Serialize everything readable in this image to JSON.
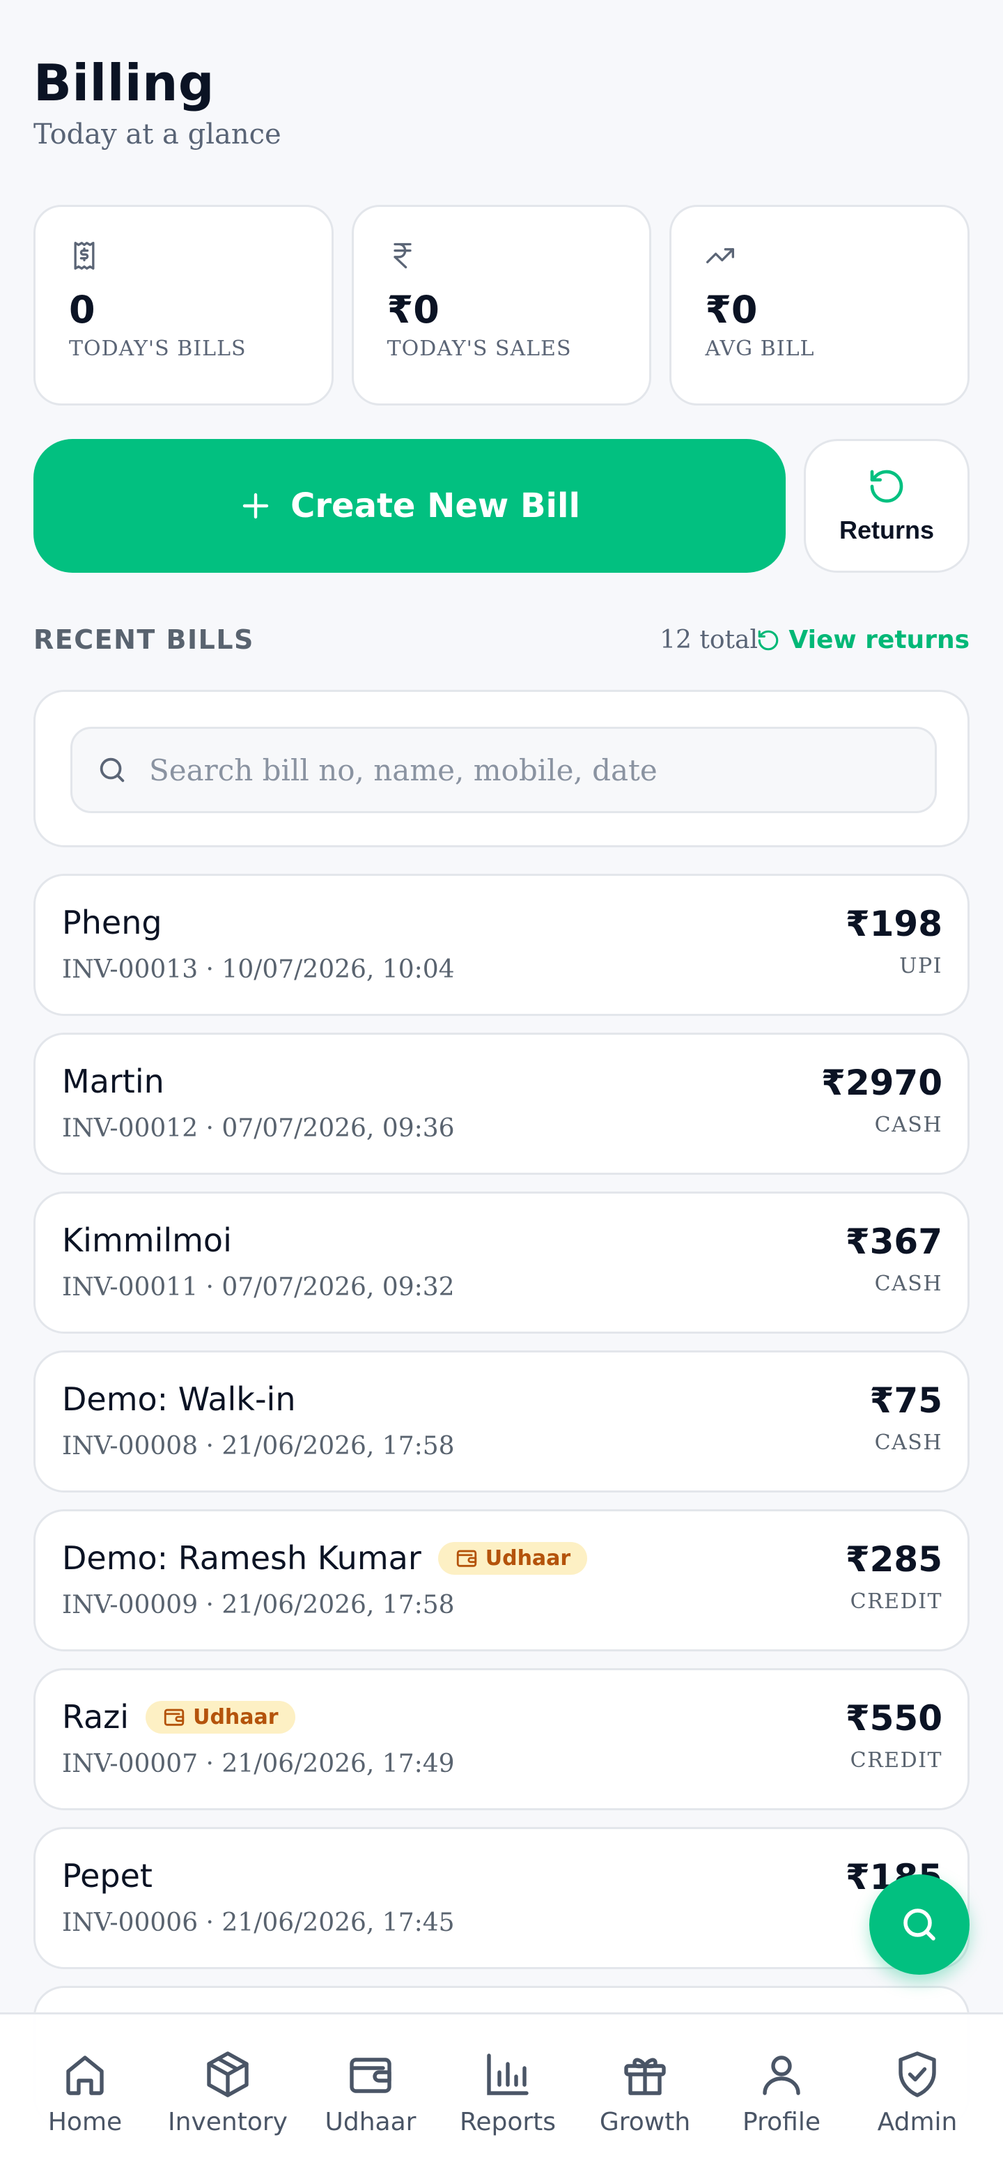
{
  "header": {
    "title": "Billing",
    "subtitle": "Today at a glance"
  },
  "stats": [
    {
      "icon": "receipt-icon",
      "value": "0",
      "label": "TODAY'S BILLS"
    },
    {
      "icon": "rupee-icon",
      "value": "₹0",
      "label": "TODAY'S SALES"
    },
    {
      "icon": "trending-up-icon",
      "value": "₹0",
      "label": "AVG BILL"
    }
  ],
  "actions": {
    "create_label": "Create New Bill",
    "returns_label": "Returns"
  },
  "recent": {
    "title": "RECENT BILLS",
    "total": "12 total",
    "view_returns": "View returns"
  },
  "search": {
    "placeholder": "Search bill no, name, mobile, date",
    "value": ""
  },
  "bills": [
    {
      "name": "Pheng",
      "meta": "INV-00013 · 10/07/2026, 10:04",
      "amount": "₹198",
      "method": "UPI",
      "badge": ""
    },
    {
      "name": "Martin",
      "meta": "INV-00012 · 07/07/2026, 09:36",
      "amount": "₹2970",
      "method": "CASH",
      "badge": ""
    },
    {
      "name": "Kimmilmoi",
      "meta": "INV-00011 · 07/07/2026, 09:32",
      "amount": "₹367",
      "method": "CASH",
      "badge": ""
    },
    {
      "name": "Demo: Walk-in",
      "meta": "INV-00008 · 21/06/2026, 17:58",
      "amount": "₹75",
      "method": "CASH",
      "badge": ""
    },
    {
      "name": "Demo: Ramesh Kumar",
      "meta": "INV-00009 · 21/06/2026, 17:58",
      "amount": "₹285",
      "method": "CREDIT",
      "badge": "Udhaar"
    },
    {
      "name": "Razi",
      "meta": "INV-00007 · 21/06/2026, 17:49",
      "amount": "₹550",
      "method": "CREDIT",
      "badge": "Udhaar"
    },
    {
      "name": "Pepet",
      "meta": "INV-00006 · 21/06/2026, 17:45",
      "amount": "₹185",
      "method": "",
      "badge": ""
    }
  ],
  "nav": [
    {
      "label": "Home",
      "icon": "home-icon"
    },
    {
      "label": "Inventory",
      "icon": "box-icon"
    },
    {
      "label": "Udhaar",
      "icon": "wallet-icon"
    },
    {
      "label": "Reports",
      "icon": "bar-chart-icon"
    },
    {
      "label": "Growth",
      "icon": "gift-icon"
    },
    {
      "label": "Profile",
      "icon": "user-icon"
    },
    {
      "label": "Admin",
      "icon": "shield-check-icon"
    }
  ],
  "colors": {
    "accent": "#02c080",
    "badge_bg": "#fdf0c4",
    "badge_text": "#b4530b"
  }
}
